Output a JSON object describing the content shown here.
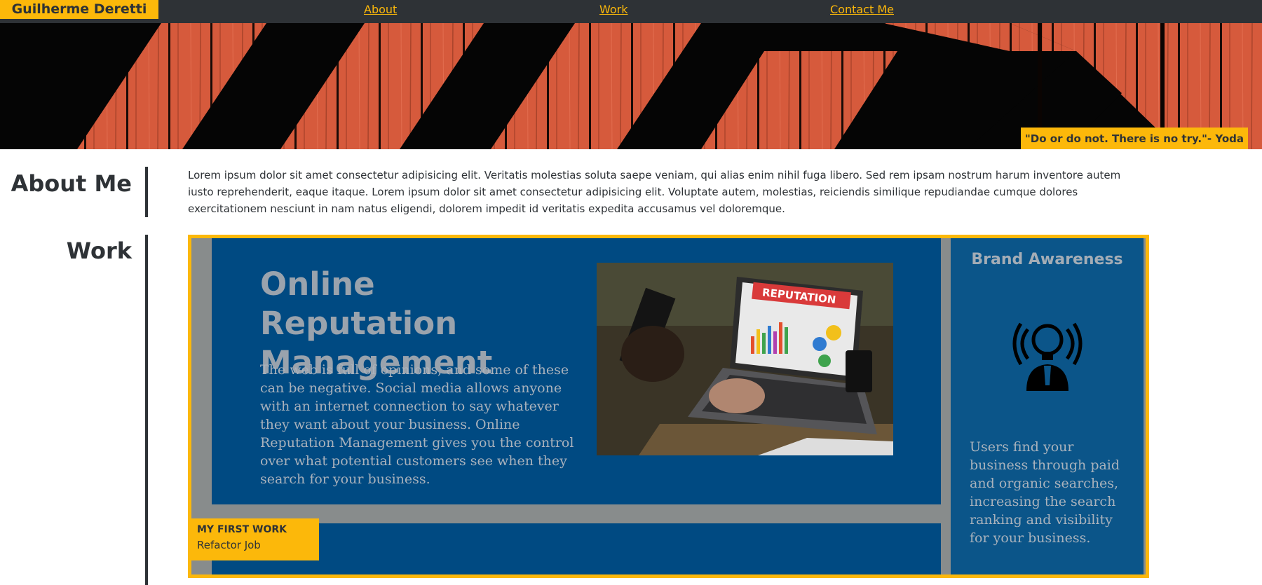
{
  "nav": {
    "brand": "Guilherme Deretti",
    "links": [
      {
        "label": "About"
      },
      {
        "label": "Work"
      },
      {
        "label": "Contact Me"
      }
    ]
  },
  "hero": {
    "quote": "\"Do or do not. There is no try.\"- Yoda"
  },
  "about": {
    "title": "About Me",
    "text": "Lorem ipsum dolor sit amet consectetur adipisicing elit. Veritatis molestias soluta saepe veniam, qui alias enim nihil fuga libero. Sed rem ipsam nostrum harum inventore autem iusto reprehenderit, eaque itaque. Lorem ipsum dolor sit amet consectetur adipisicing elit. Voluptate autem, molestias, reiciendis similique repudiandae cumque dolores exercitationem nesciunt in nam natus eligendi, dolorem impedit id veritatis expedita accusamus vel doloremque."
  },
  "work": {
    "title": "Work",
    "card": {
      "orm_title": "Online Reputation Management",
      "orm_body": "The web is full of opinions, and some of these can be negative. Social media allows anyone with an internet connection to say whatever they want about your business. Online Reputation Management gives you the control over what potential customers see when they search for your business.",
      "photo_sign": "REPUTATION",
      "brand_title": "Brand Awareness",
      "brand_body": "Users find your business through paid and organic searches, increasing the search ranking and visibility for your business.",
      "label_title": "MY FIRST WORK",
      "label_subtitle": "Refactor Job"
    }
  },
  "colors": {
    "accent": "#fcb80a",
    "dark": "#2e3236",
    "panel_blue": "#004a82",
    "hero_wood": "#d65a3c"
  }
}
